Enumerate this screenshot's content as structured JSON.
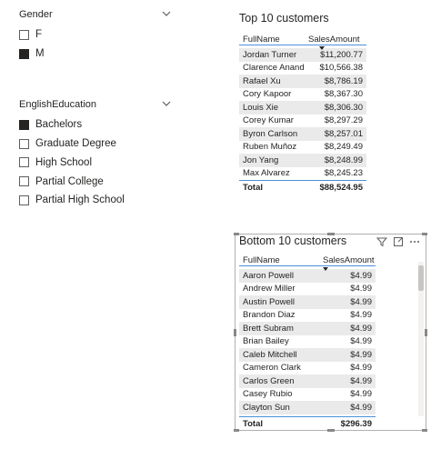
{
  "gender_slicer": {
    "title": "Gender",
    "items": [
      {
        "label": "F",
        "checked": false
      },
      {
        "label": "M",
        "checked": true
      }
    ]
  },
  "education_slicer": {
    "title": "EnglishEducation",
    "items": [
      {
        "label": "Bachelors",
        "checked": true
      },
      {
        "label": "Graduate Degree",
        "checked": false
      },
      {
        "label": "High School",
        "checked": false
      },
      {
        "label": "Partial College",
        "checked": false
      },
      {
        "label": "Partial High School",
        "checked": false
      }
    ]
  },
  "top_table": {
    "title": "Top 10 customers",
    "columns": [
      "FullName",
      "SalesAmount"
    ],
    "rows": [
      [
        "Jordan Turner",
        "$11,200.77"
      ],
      [
        "Clarence Anand",
        "$10,566.38"
      ],
      [
        "Rafael Xu",
        "$8,786.19"
      ],
      [
        "Cory Kapoor",
        "$8,367.30"
      ],
      [
        "Louis Xie",
        "$8,306.30"
      ],
      [
        "Corey Kumar",
        "$8,297.29"
      ],
      [
        "Byron Carlson",
        "$8,257.01"
      ],
      [
        "Ruben Muñoz",
        "$8,249.49"
      ],
      [
        "Jon Yang",
        "$8,248.99"
      ],
      [
        "Max Alvarez",
        "$8,245.23"
      ]
    ],
    "total_label": "Total",
    "total_value": "$88,524.95"
  },
  "bottom_table": {
    "title": "Bottom 10 customers",
    "columns": [
      "FullName",
      "SalesAmount"
    ],
    "rows": [
      [
        "Aaron Powell",
        "$4.99"
      ],
      [
        "Andrew Miller",
        "$4.99"
      ],
      [
        "Austin Powell",
        "$4.99"
      ],
      [
        "Brandon Diaz",
        "$4.99"
      ],
      [
        "Brett Subram",
        "$4.99"
      ],
      [
        "Brian Bailey",
        "$4.99"
      ],
      [
        "Caleb Mitchell",
        "$4.99"
      ],
      [
        "Cameron Clark",
        "$4.99"
      ],
      [
        "Carlos Green",
        "$4.99"
      ],
      [
        "Casey Rubio",
        "$4.99"
      ],
      [
        "Clayton Sun",
        "$4.99"
      ]
    ],
    "total_label": "Total",
    "total_value": "$296.39"
  },
  "colors": {
    "header_rule": "#4a90d9",
    "checked_fill": "#252423",
    "alt_row": "#eaeaea"
  },
  "icons": [
    "chevron-down-icon",
    "filter-icon",
    "focus-mode-icon",
    "more-options-icon"
  ]
}
